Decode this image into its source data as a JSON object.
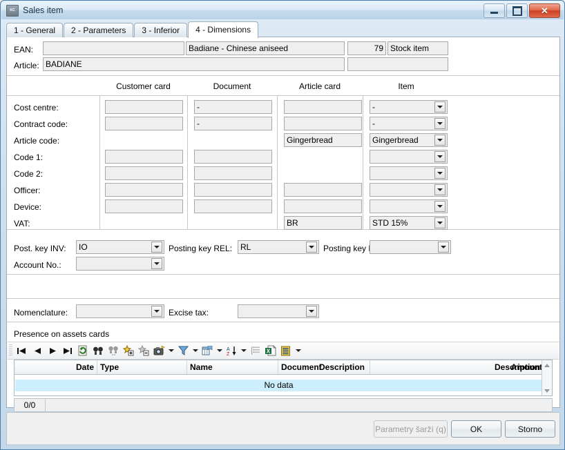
{
  "window": {
    "title": "Sales item",
    "icon": "app-icon",
    "buttons": {
      "minimize": "minimize",
      "maximize": "maximize",
      "close": "close"
    }
  },
  "tabs": [
    {
      "label": "1 - General",
      "active": false
    },
    {
      "label": "2 - Parameters",
      "active": false
    },
    {
      "label": "3 - Inferior",
      "active": false
    },
    {
      "label": "4 - Dimensions",
      "active": true
    }
  ],
  "header": {
    "ean_label": "EAN:",
    "ean_value": "",
    "description_value": "Badiane - Chinese aniseed",
    "number_value": "79",
    "kind_value": "Stock item",
    "article_label": "Article:",
    "article_value": "BADIANE",
    "article_extra_value": ""
  },
  "dimensions": {
    "columns": [
      "Customer card",
      "Document",
      "Article card",
      "Item"
    ],
    "rows": [
      {
        "label": "Cost centre:",
        "customer": "",
        "document": "-",
        "article": "",
        "item": "-"
      },
      {
        "label": "Contract code:",
        "customer": "",
        "document": "-",
        "article": "",
        "item": "-"
      },
      {
        "label": "Article code:",
        "customer": null,
        "document": null,
        "article": "Gingerbread",
        "item": "Gingerbread"
      },
      {
        "label": "Code 1:",
        "customer": "",
        "document": "",
        "article": null,
        "item": ""
      },
      {
        "label": "Code 2:",
        "customer": "",
        "document": "",
        "article": null,
        "item": ""
      },
      {
        "label": "Officer:",
        "customer": "",
        "document": "",
        "article": "",
        "item": ""
      },
      {
        "label": "Device:",
        "customer": "",
        "document": "",
        "article": "",
        "item": ""
      },
      {
        "label": "VAT:",
        "customer": null,
        "document": null,
        "article": "BR",
        "item": "STD 15%"
      }
    ]
  },
  "posting": {
    "inv_label": "Post. key INV:",
    "inv_value": "IO",
    "rel_label": "Posting key REL:",
    "rel_value": "RL",
    "rem_label": "Posting key RE",
    "rem_value": "",
    "account_label": "Account No.:",
    "account_value": ""
  },
  "misc": {
    "nomenclature_label": "Nomenclature:",
    "nomenclature_value": "",
    "excise_label": "Excise tax:",
    "excise_value": ""
  },
  "assets": {
    "section_title": "Presence on assets cards",
    "toolbar": [
      "first-record-icon",
      "previous-record-icon",
      "next-record-icon",
      "last-record-icon",
      "refresh-icon",
      "find-icon",
      "find-next-icon",
      "add-record-icon",
      "delete-record-icon",
      "snapshot-icon",
      "filter-icon",
      "columns-icon",
      "sort-icon",
      "group-icon",
      "export-excel-icon",
      "report-icon"
    ],
    "columns": [
      "Date",
      "Type",
      "Name",
      "Document",
      "Description",
      "Amount"
    ],
    "empty_text": "No data",
    "status_count": "0/0"
  },
  "footer": {
    "batch_params_label": "Parametry šarží (q)",
    "ok_label": "OK",
    "cancel_label": "Storno"
  }
}
